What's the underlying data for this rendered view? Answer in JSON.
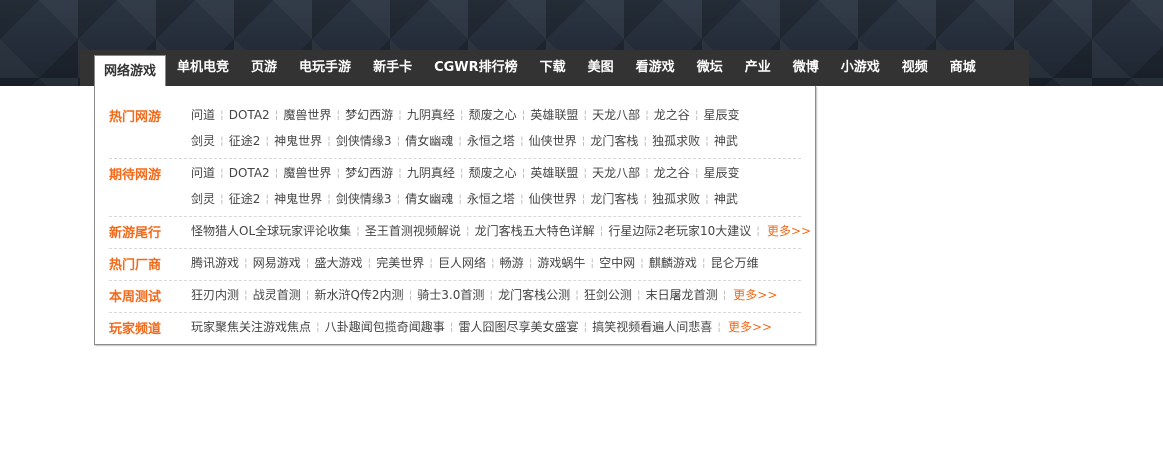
{
  "nav": {
    "items": [
      "网络游戏",
      "单机电竞",
      "页游",
      "电玩手游",
      "新手卡",
      "CGWR排行榜",
      "下载",
      "美图",
      "看游戏",
      "微坛",
      "产业",
      "微博",
      "小游戏",
      "视频",
      "商城"
    ]
  },
  "dropdown": {
    "hot": {
      "title": "热门网游",
      "line1": [
        "问道",
        "DOTA2",
        "魔兽世界",
        "梦幻西游",
        "九阴真经",
        "颓废之心",
        "英雄联盟",
        "天龙八部",
        "龙之谷",
        "星辰变"
      ],
      "line2": [
        "剑灵",
        "征途2",
        "神鬼世界",
        "剑侠情缘3",
        "倩女幽魂",
        "永恒之塔",
        "仙侠世界",
        "龙门客栈",
        "独孤求败",
        "神武"
      ]
    },
    "upcoming": {
      "title": "期待网游",
      "line1": [
        "问道",
        "DOTA2",
        "魔兽世界",
        "梦幻西游",
        "九阴真经",
        "颓废之心",
        "英雄联盟",
        "天龙八部",
        "龙之谷",
        "星辰变"
      ],
      "line2": [
        "剑灵",
        "征途2",
        "神鬼世界",
        "剑侠情缘3",
        "倩女幽魂",
        "永恒之塔",
        "仙侠世界",
        "龙门客栈",
        "独孤求败",
        "神武"
      ]
    },
    "newgames": {
      "title": "新游尾行",
      "links": [
        "怪物猎人OL全球玩家评论收集",
        "圣王首测视频解说",
        "龙门客栈五大特色详解",
        "行星边际2老玩家10大建议"
      ],
      "more": "更多>>"
    },
    "vendors": {
      "title": "热门厂商",
      "links": [
        "腾讯游戏",
        "网易游戏",
        "盛大游戏",
        "完美世界",
        "巨人网络",
        "畅游",
        "游戏蜗牛",
        "空中网",
        "麒麟游戏",
        "昆仑万维"
      ]
    },
    "weekly": {
      "title": "本周测试",
      "links": [
        "狂刃内测",
        "战灵首测",
        "新水浒Q传2内测",
        "骑士3.0首测",
        "龙门客栈公测",
        "狂剑公测",
        "末日屠龙首测"
      ],
      "more": "更多>>"
    },
    "players": {
      "title": "玩家频道",
      "links": [
        "玩家聚焦关注游戏焦点",
        "八卦趣闻包揽奇闻趣事",
        "雷人囧图尽享美女盛宴",
        "搞笑视频看遍人间悲喜"
      ],
      "more": "更多>>"
    }
  }
}
